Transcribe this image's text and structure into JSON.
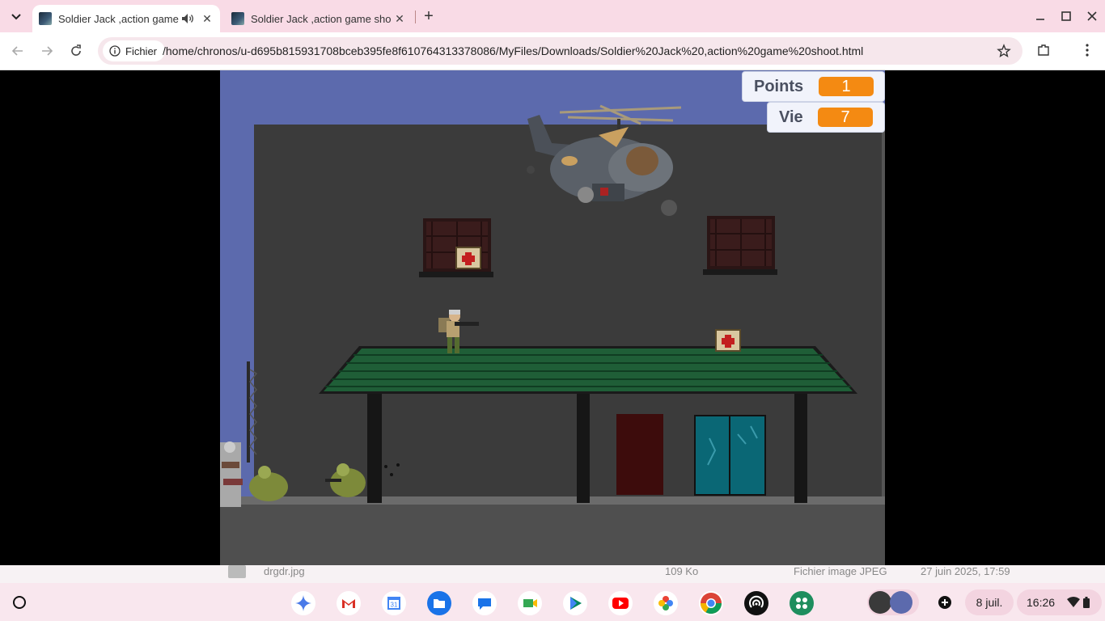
{
  "tabs": [
    {
      "title": "Soldier Jack ,action game s",
      "active": true,
      "audio": true
    },
    {
      "title": "Soldier Jack ,action game shoo",
      "active": false
    }
  ],
  "toolbar": {
    "site_chip": "Fichier",
    "url": "/home/chronos/u-d695b815931708bceb395fe8f610764313378086/MyFiles/Downloads/Soldier%20Jack%20,action%20game%20shoot.html"
  },
  "game": {
    "points_label": "Points",
    "points_value": "1",
    "life_label": "Vie",
    "life_value": "7"
  },
  "underlay": {
    "file_name": "drgdr.jpg",
    "file_size": "109 Ko",
    "file_type": "Fichier image JPEG",
    "file_date": "27 juin 2025, 17:59"
  },
  "shelf": {
    "date": "8 juil.",
    "time": "16:26",
    "apps": [
      "gemini-icon",
      "gmail-icon",
      "calendar-icon",
      "files-icon",
      "messages-icon",
      "meet-icon",
      "play-store-icon",
      "youtube-icon",
      "photos-icon",
      "chrome-icon",
      "podcast-icon",
      "app-grid-icon"
    ]
  },
  "colors": {
    "tab_strip": "#f9dbe6",
    "game_sky": "#5c6aad",
    "hud_value": "#f48a12",
    "building": "#3b3b3b",
    "roof": "#1f5e37"
  }
}
